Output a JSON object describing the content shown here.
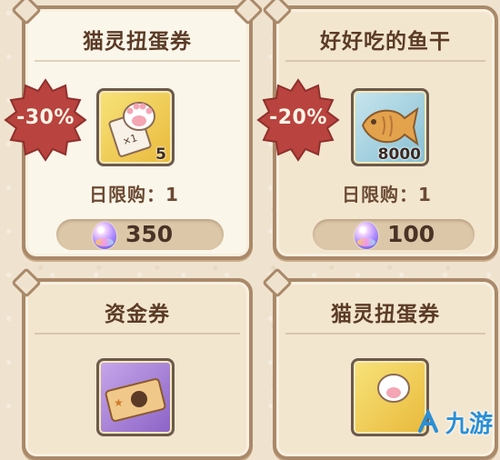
{
  "cards": [
    {
      "title": "猫灵扭蛋券",
      "badge": "-30%",
      "quantity": "5",
      "daily_limit": "日限购：1",
      "price": "350"
    },
    {
      "title": "好好吃的鱼干",
      "badge": "-20%",
      "quantity": "8000",
      "daily_limit": "日限购：1",
      "price": "100"
    },
    {
      "title": "资金券"
    },
    {
      "title": "猫灵扭蛋券"
    }
  ],
  "icons": {
    "ticket_paw": "gacha-ticket-icon",
    "fish": "dried-fish-icon",
    "fund_ticket": "fund-ticket-icon",
    "gem": "gem-currency-icon"
  },
  "watermark": "九游",
  "colors": {
    "badge": "#b8433f",
    "title": "#5b3b26",
    "frame": "#a9896a"
  }
}
